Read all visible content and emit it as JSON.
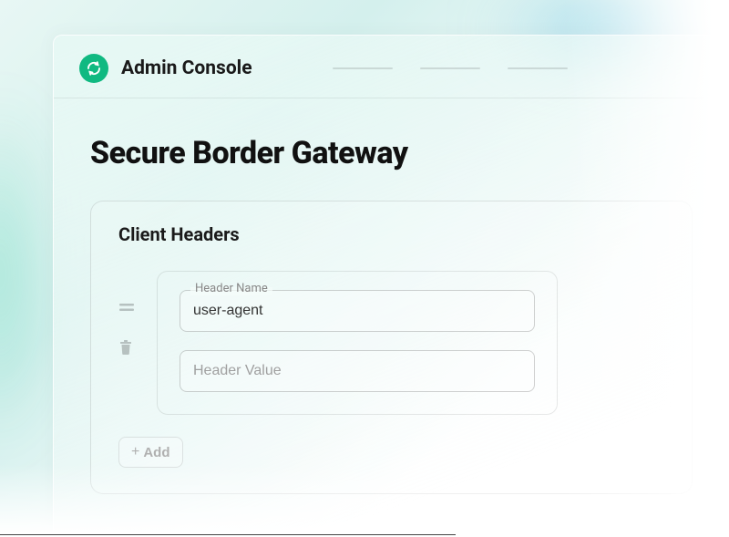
{
  "header": {
    "brand": "Admin Console"
  },
  "page": {
    "title": "Secure Border Gateway"
  },
  "panel": {
    "title": "Client Headers",
    "fields": {
      "name_label": "Header Name",
      "name_value": "user-agent",
      "value_placeholder": "Header Value"
    },
    "add_label": "Add"
  },
  "colors": {
    "accent": "#10b981"
  }
}
